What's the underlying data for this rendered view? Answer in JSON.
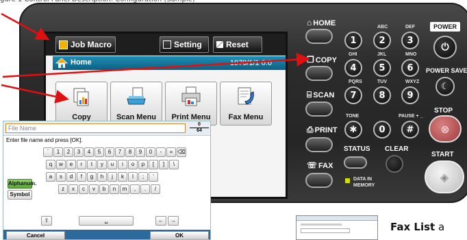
{
  "caption_top": "gure 1 Control Panel Description: Configuration (Sample)",
  "screen": {
    "job_macro": "Job Macro",
    "setting": "Setting",
    "reset": "Reset",
    "home_title": "Home",
    "datetime": "1970/1/1 0:0",
    "tiles": [
      "Copy",
      "Scan Menu",
      "Print Menu",
      "Fax Menu"
    ]
  },
  "hardkeys": {
    "home": "HOME",
    "copy": "COPY",
    "scan": "SCAN",
    "print": "PRINT",
    "fax": "FAX",
    "status": "STATUS",
    "clear": "CLEAR",
    "data_in_memory_1": "DATA IN",
    "data_in_memory_2": "MEMORY",
    "power": "POWER",
    "power_save": "POWER SAVE",
    "stop": "STOP",
    "start": "START",
    "pause": "PAUSE + _",
    "tone": "TONE",
    "digits": [
      "1",
      "2",
      "3",
      "4",
      "5",
      "6",
      "7",
      "8",
      "9",
      "✱",
      "0",
      "#"
    ],
    "letters": [
      "",
      "ABC",
      "DEF",
      "GHI",
      "JKL",
      "MNO",
      "PQRS",
      "TUV",
      "WXYZ"
    ]
  },
  "keyboard": {
    "placeholder": "File Name",
    "count_top": "0",
    "count_bottom": "64",
    "instruction": "Enter file name and press [OK].",
    "row1": [
      "`",
      "1",
      "2",
      "3",
      "4",
      "5",
      "6",
      "7",
      "8",
      "9",
      "0",
      "-",
      "=",
      "⌫"
    ],
    "row2": [
      "q",
      "w",
      "e",
      "r",
      "t",
      "y",
      "u",
      "i",
      "o",
      "p",
      "[",
      "]",
      "\\"
    ],
    "row3": [
      "a",
      "s",
      "d",
      "f",
      "g",
      "h",
      "j",
      "k",
      "l",
      ";",
      "'"
    ],
    "row4": [
      "z",
      "x",
      "c",
      "v",
      "b",
      "n",
      "m",
      ",",
      ".",
      "/"
    ],
    "alphanum": "Alphanum.",
    "symbol": "Symbol",
    "shift": "⇧",
    "space": "␣",
    "left": "←",
    "right": "→",
    "cancel": "Cancel",
    "ok": "OK"
  },
  "footer": {
    "fax_list_bold": "Fax List",
    "fax_list_rest": " a"
  },
  "colors": {
    "panel": "#2c2c2c",
    "homebar": "#1f8fb6",
    "arrow": "#e01010",
    "stop": "#b84a4a",
    "led": "#d6e000"
  }
}
